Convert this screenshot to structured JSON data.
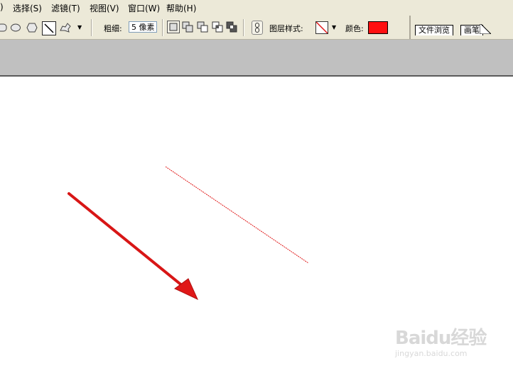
{
  "menubar": {
    "items": [
      {
        "label": ")"
      },
      {
        "label": "选择(S)"
      },
      {
        "label": "滤镜(T)"
      },
      {
        "label": "视图(V)"
      },
      {
        "label": "窗口(W)"
      },
      {
        "label": "帮助(H)"
      }
    ]
  },
  "options": {
    "shape_tools": [
      "rounded-rectangle-icon",
      "ellipse-icon",
      "polygon-icon",
      "line-icon",
      "custom-shape-icon"
    ],
    "selected_tool": "line-icon",
    "weight_label": "粗细:",
    "weight_value": "5 像素",
    "layer_style_label": "图层样式:",
    "color_label": "颜色:",
    "color_value": "#ff1010"
  },
  "palette_well": {
    "tabs": [
      {
        "label": "文件浏览"
      },
      {
        "label": "画笔"
      }
    ]
  },
  "watermark": {
    "brand": "Baidu经验",
    "url": "jingyan.baidu.com"
  },
  "colors": {
    "chrome": "#ece9d8",
    "gray_band": "#c0c0c0",
    "arrow_red": "#e01818"
  }
}
